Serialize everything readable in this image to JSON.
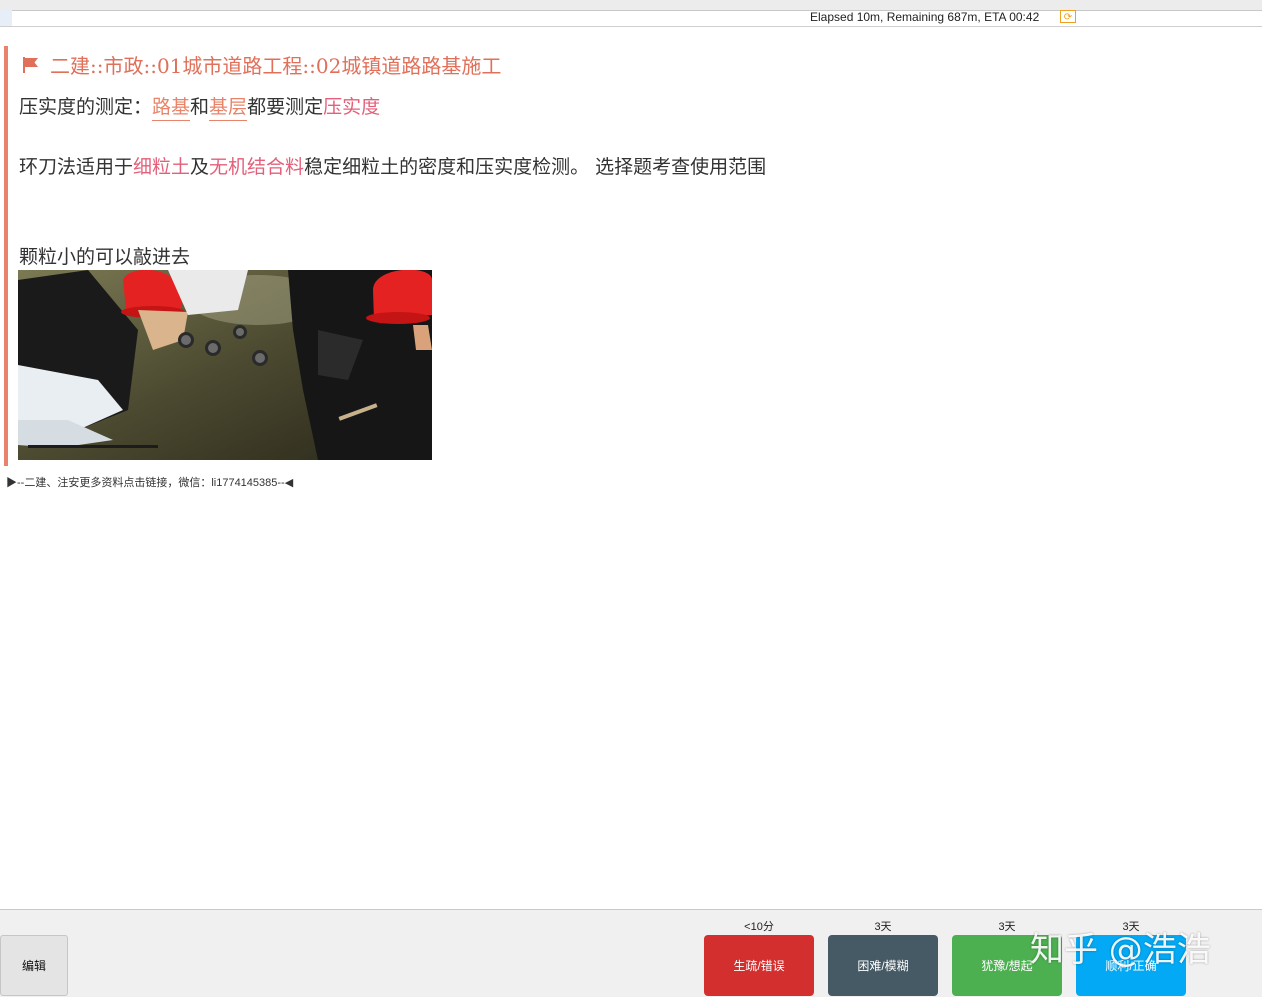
{
  "status": {
    "progress_text": "Elapsed 10m, Remaining 687m, ETA 00:42"
  },
  "card": {
    "deck_path": "二建::市政::01城市道路工程::02城镇道路路基施工",
    "line1": {
      "prefix": "压实度的测定：",
      "term1": "路基",
      "and": "和",
      "term2": "基层",
      "middle": "都要测定",
      "term3": "压实度"
    },
    "line2": {
      "prefix": "环刀法适用于",
      "term1": "细粒土",
      "and": "及",
      "term2": "无机结合料",
      "suffix": "稳定细粒土的密度和压实度检测。 选择题考查使用范围"
    },
    "line3": "颗粒小的可以敲进去",
    "footer_note": "▶--二建、注安更多资料点击链接，微信：li1774145385--◀"
  },
  "bottom": {
    "edit_label": "编辑",
    "answers": [
      {
        "interval": "<10分",
        "label": "生疏/错误",
        "color": "#d32f2f"
      },
      {
        "interval": "3天",
        "label": "困难/模糊",
        "color": "#455a64"
      },
      {
        "interval": "3天",
        "label": "犹豫/想起",
        "color": "#4caf50"
      },
      {
        "interval": "3天",
        "label": "顺利/正确",
        "color": "#03a9f4"
      }
    ],
    "watermark": "知乎 @浩浩"
  }
}
